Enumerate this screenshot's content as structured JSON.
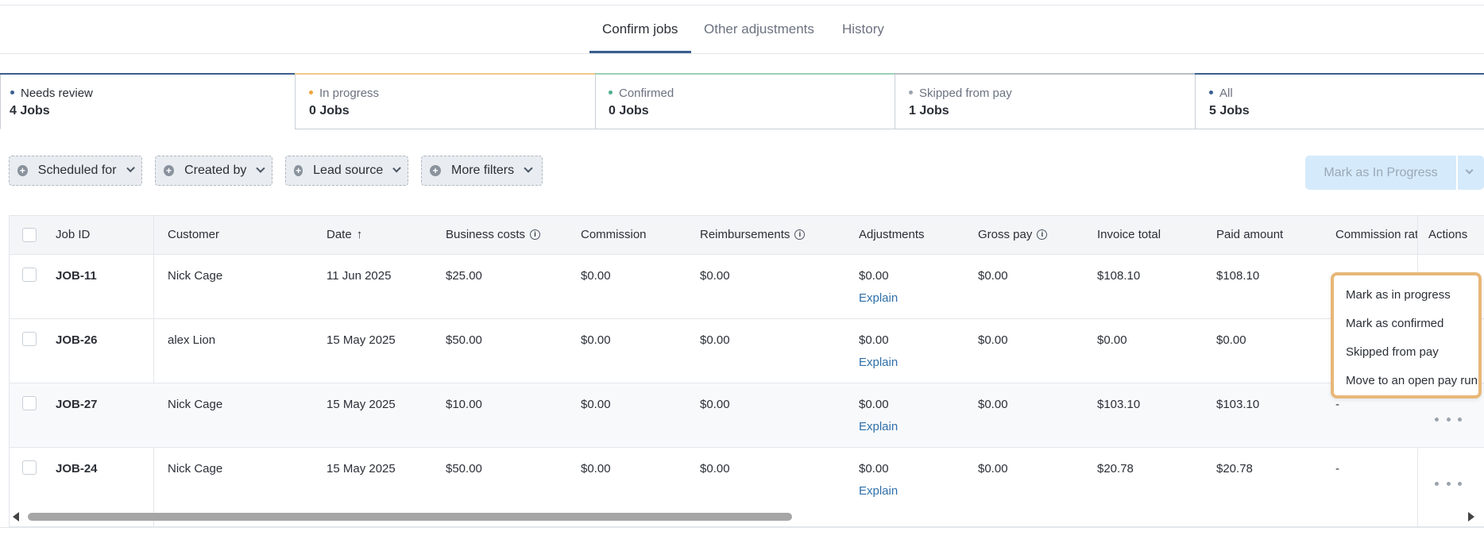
{
  "top_tabs": [
    {
      "label": "Confirm jobs",
      "active": true
    },
    {
      "label": "Other adjustments",
      "active": false
    },
    {
      "label": "History",
      "active": false
    }
  ],
  "status_cards": [
    {
      "label": "Needs review",
      "count": "4 Jobs",
      "color": "#3a5f8f",
      "active": true
    },
    {
      "label": "In progress",
      "count": "0 Jobs",
      "color": "#f0a53a",
      "active": false
    },
    {
      "label": "Confirmed",
      "count": "0 Jobs",
      "color": "#4caf8a",
      "active": false
    },
    {
      "label": "Skipped from pay",
      "count": "1 Jobs",
      "color": "#9aa3ad",
      "active": false
    },
    {
      "label": "All",
      "count": "5 Jobs",
      "color": "#3a5f8f",
      "active": false
    }
  ],
  "filters": [
    {
      "label": "Scheduled for"
    },
    {
      "label": "Created by"
    },
    {
      "label": "Lead source"
    },
    {
      "label": "More filters"
    }
  ],
  "actions": {
    "primary_label": "Mark as In Progress"
  },
  "table": {
    "columns": {
      "job_id": "Job ID",
      "customer": "Customer",
      "date": "Date",
      "business_costs": "Business costs",
      "commission": "Commission",
      "reimbursements": "Reimbursements",
      "adjustments": "Adjustments",
      "gross_pay": "Gross pay",
      "invoice_total": "Invoice total",
      "paid_amount": "Paid amount",
      "commission_rate": "Commission rat",
      "actions": "Actions"
    },
    "rows": [
      {
        "job_id": "JOB-11",
        "customer": "Nick Cage",
        "date": "11 Jun 2025",
        "business_costs": "$25.00",
        "commission": "$0.00",
        "reimbursements": "$0.00",
        "adjustments": "$0.00",
        "explain": "Explain",
        "gross_pay": "$0.00",
        "invoice_total": "$108.10",
        "paid_amount": "$108.10",
        "commission_rate": ""
      },
      {
        "job_id": "JOB-26",
        "customer": "alex Lion",
        "date": "15 May 2025",
        "business_costs": "$50.00",
        "commission": "$0.00",
        "reimbursements": "$0.00",
        "adjustments": "$0.00",
        "explain": "Explain",
        "gross_pay": "$0.00",
        "invoice_total": "$0.00",
        "paid_amount": "$0.00",
        "commission_rate": ""
      },
      {
        "job_id": "JOB-27",
        "customer": "Nick Cage",
        "date": "15 May 2025",
        "business_costs": "$10.00",
        "commission": "$0.00",
        "reimbursements": "$0.00",
        "adjustments": "$0.00",
        "explain": "Explain",
        "gross_pay": "$0.00",
        "invoice_total": "$103.10",
        "paid_amount": "$103.10",
        "commission_rate": "-"
      },
      {
        "job_id": "JOB-24",
        "customer": "Nick Cage",
        "date": "15 May 2025",
        "business_costs": "$50.00",
        "commission": "$0.00",
        "reimbursements": "$0.00",
        "adjustments": "$0.00",
        "explain": "Explain",
        "gross_pay": "$0.00",
        "invoice_total": "$20.78",
        "paid_amount": "$20.78",
        "commission_rate": "-"
      }
    ]
  },
  "row_menu": {
    "items": [
      "Mark as in progress",
      "Mark as confirmed",
      "Skipped from pay",
      "Move to an open pay run"
    ]
  },
  "colors": {
    "accent": "#3a5f8f",
    "link": "#2f6fa8",
    "menu_highlight": "#e8b778"
  },
  "icons": [
    "plus-circle-icon",
    "chevron-down-icon",
    "info-icon",
    "sort-arrow-up-icon",
    "more-dots-icon"
  ]
}
